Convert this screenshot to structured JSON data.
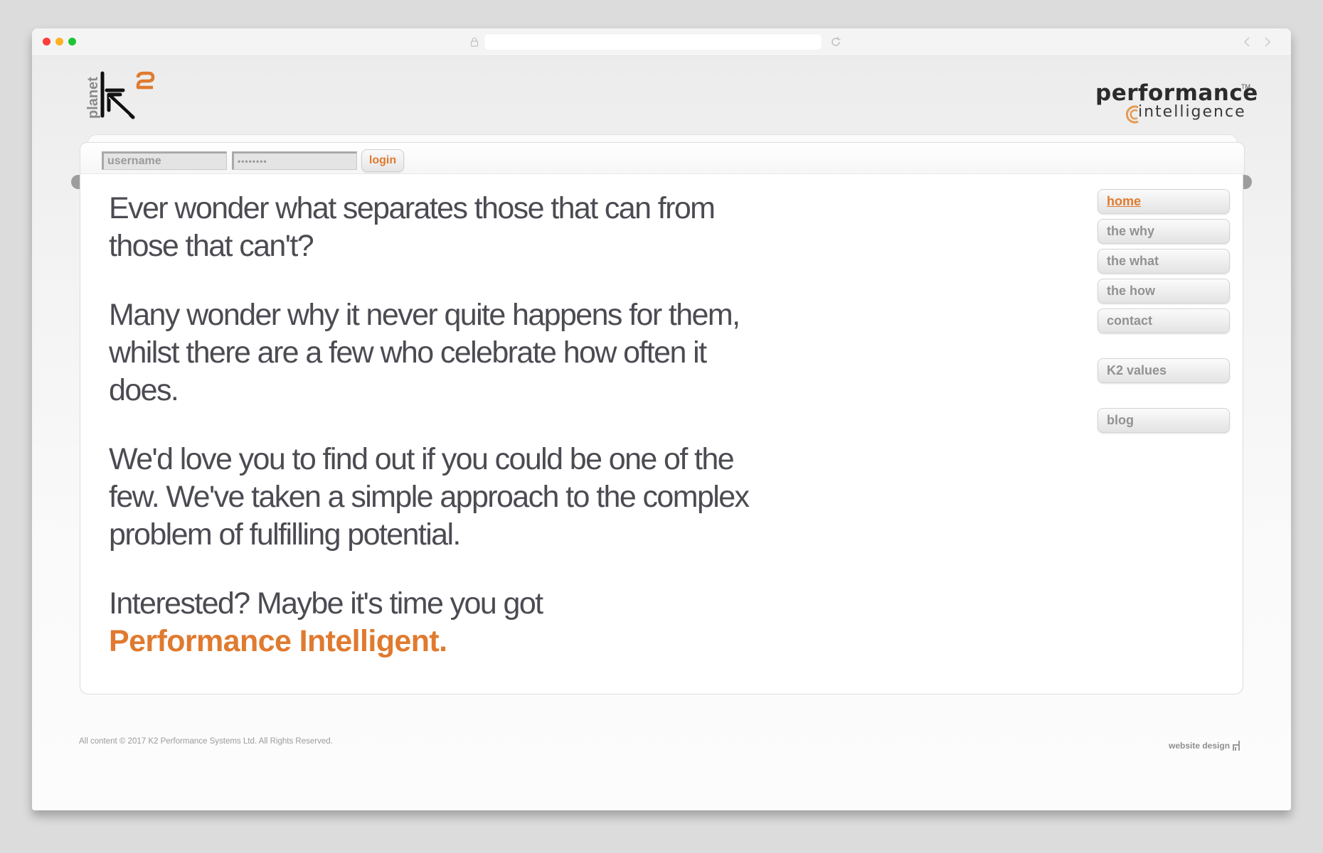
{
  "browser": {
    "traffic_lights": [
      "close",
      "minimize",
      "zoom"
    ],
    "url": "",
    "icons": [
      "lock-icon",
      "reload-icon",
      "back-icon",
      "forward-icon"
    ]
  },
  "header": {
    "k2_logo": {
      "word": "planet",
      "letter": "k",
      "superscript": "2"
    },
    "pi_logo": {
      "line1": "performance",
      "tm": "TM",
      "line2": "intelligence"
    }
  },
  "login": {
    "username_placeholder": "username",
    "username_value": "username",
    "password_value": "••••••••",
    "button_label": "login"
  },
  "main": {
    "paragraphs": [
      "Ever wonder what separates those that can from those that can't?",
      "Many wonder why it never quite happens for them, whilst there are a few who celebrate how often it does.",
      "We'd love you to find out if you could be one of the few. We've taken a simple approach to the complex problem of fulfilling potential.",
      "Interested? Maybe it's time you got"
    ],
    "accent_text": "Performance Intelligent."
  },
  "nav": {
    "items": [
      {
        "label": "home",
        "active": true
      },
      {
        "label": "the why",
        "active": false
      },
      {
        "label": "the what",
        "active": false
      },
      {
        "label": "the how",
        "active": false
      },
      {
        "label": "contact",
        "active": false
      },
      {
        "label": "K2 values",
        "active": false
      },
      {
        "label": "blog",
        "active": false
      }
    ]
  },
  "footer": {
    "copyright": "All content © 2017 K2 Performance Systems Ltd. All Rights Reserved.",
    "credit": "website design"
  },
  "colors": {
    "accent": "#e07a2f",
    "body_text": "#4b4b52",
    "nav_text": "#929292"
  }
}
